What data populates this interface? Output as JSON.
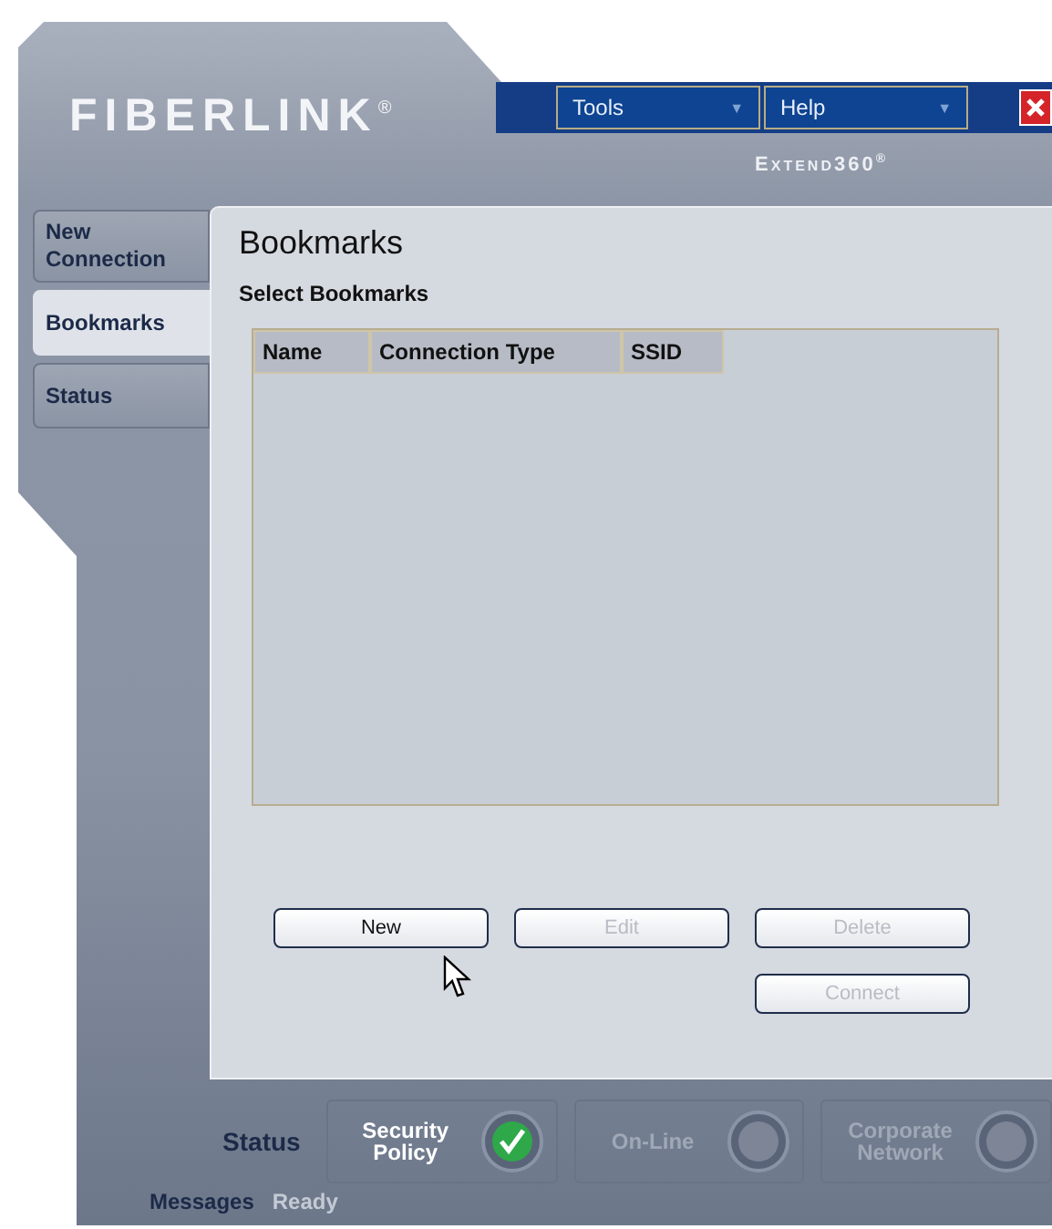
{
  "window": {
    "logo": "FIBERLINK",
    "logo_mark": "®",
    "product": "Extend360",
    "product_mark": "®"
  },
  "menus": [
    {
      "label": "Tools",
      "arrow": "▼"
    },
    {
      "label": "Help",
      "arrow": "▼"
    }
  ],
  "tabs": [
    {
      "label": "New Connection",
      "selected": false
    },
    {
      "label": "Bookmarks",
      "selected": true
    },
    {
      "label": "Status",
      "selected": false
    }
  ],
  "panel": {
    "title": "Bookmarks",
    "subtitle": "Select Bookmarks"
  },
  "table": {
    "columns": [
      "Name",
      "Connection Type",
      "SSID"
    ]
  },
  "buttons": [
    {
      "label": "New",
      "disabled": false
    },
    {
      "label": "Edit",
      "disabled": true
    },
    {
      "label": "Delete",
      "disabled": true
    },
    {
      "label": "Connect",
      "disabled": true
    }
  ],
  "status": {
    "label": "Status",
    "items": [
      {
        "label": "Security Policy",
        "on": true
      },
      {
        "label": "On-Line",
        "on": false
      },
      {
        "label": "Corporate Network",
        "on": false
      }
    ]
  },
  "messages": {
    "label": "Messages",
    "value": "Ready"
  }
}
